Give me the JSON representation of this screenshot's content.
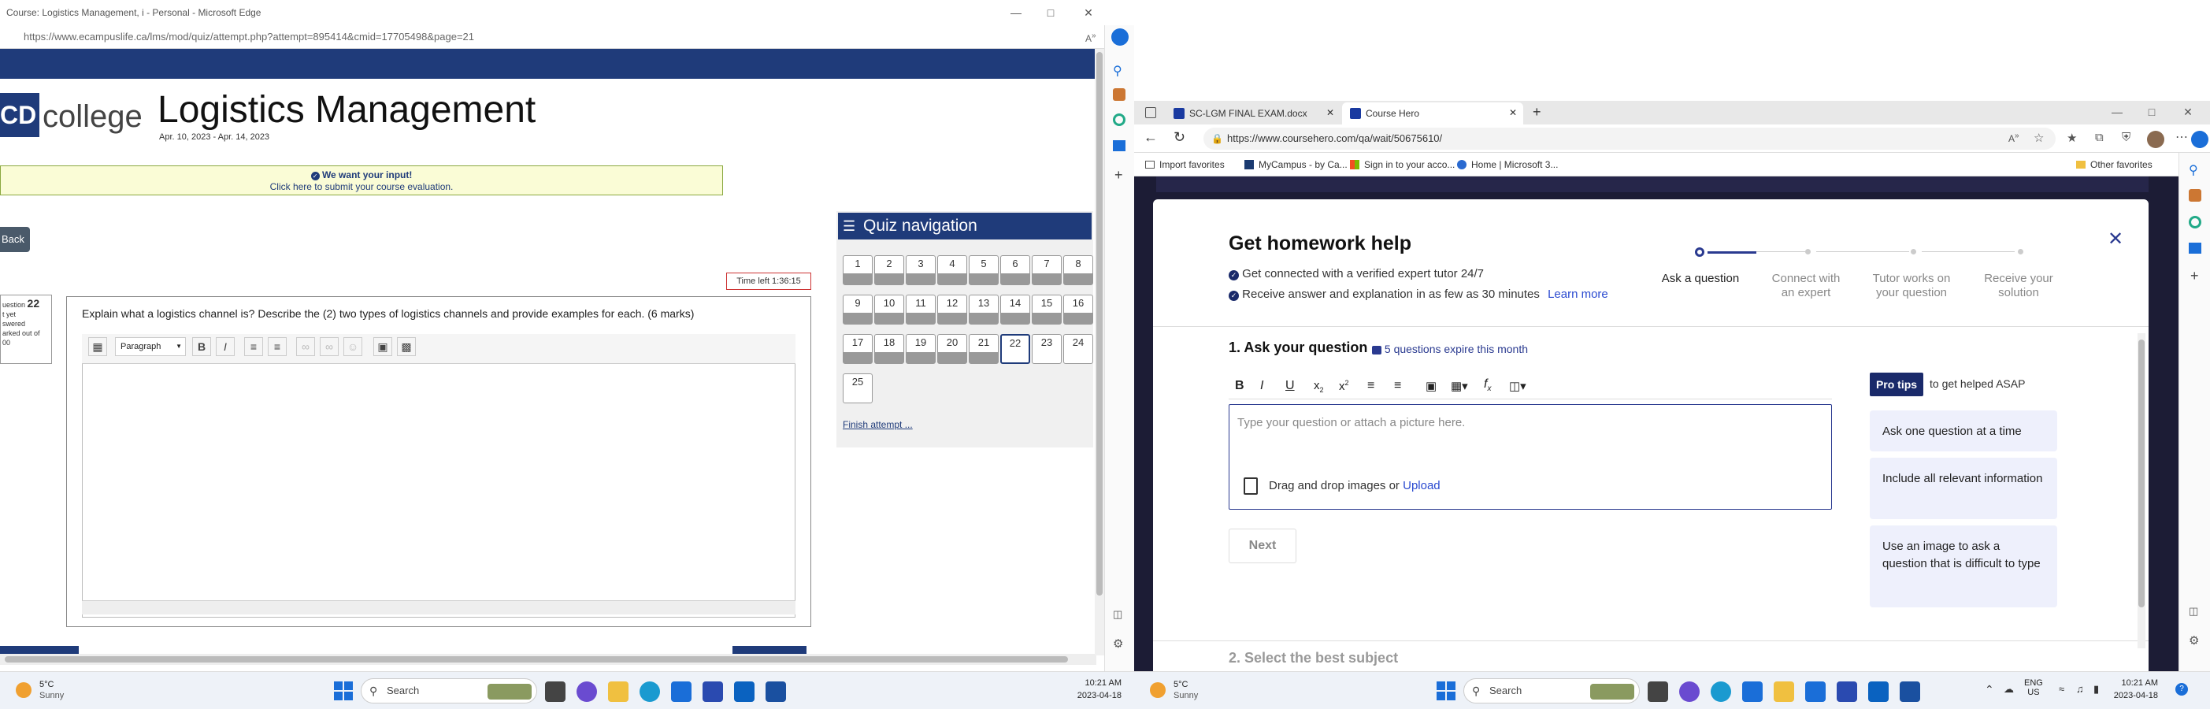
{
  "left": {
    "window_title": "Course: Logistics Management, i - Personal - Microsoft Edge",
    "url": "https://www.ecampuslife.ca/lms/mod/quiz/attempt.php?attempt=895414&cmid=17705498&page=21",
    "logo_abbr": "CD",
    "logo_college": "college",
    "course_title": "Logistics Management",
    "course_dates": "Apr. 10, 2023 - Apr. 14, 2023",
    "eval_heading": "We want your input!",
    "eval_link": "Click here to submit your course evaluation.",
    "back_label": "Back",
    "time_left": "Time left 1:36:15",
    "question_info": {
      "label": "uestion",
      "number": "22",
      "line1": "t yet",
      "line2": "swered",
      "line3": "arked out of",
      "line4": "00"
    },
    "question_text": "Explain what a logistics channel is? Describe the (2) two types of logistics channels and provide examples for each. (6 marks)",
    "editor_paragraph": "Paragraph",
    "quiz_nav_title": "Quiz navigation",
    "quiz_numbers": [
      "1",
      "2",
      "3",
      "4",
      "5",
      "6",
      "7",
      "8",
      "9",
      "10",
      "11",
      "12",
      "13",
      "14",
      "15",
      "16",
      "17",
      "18",
      "19",
      "20",
      "21",
      "22",
      "23",
      "24",
      "25"
    ],
    "current_question": "22",
    "finish_attempt": "Finish attempt ..."
  },
  "right": {
    "tabs": [
      {
        "label": "SC-LGM FINAL EXAM.docx"
      },
      {
        "label": "Course Hero"
      }
    ],
    "url": "https://www.coursehero.com/qa/wait/50675610/",
    "favorites": [
      "Import favorites",
      "MyCampus - by Ca...",
      "Sign in to your acco...",
      "Home | Microsoft 3..."
    ],
    "other_favorites": "Other favorites",
    "panel": {
      "title": "Get homework help",
      "bullet1": "Get connected with a verified expert tutor 24/7",
      "bullet2": "Receive answer and explanation in as few as 30 minutes",
      "learn_more": "Learn more",
      "steps": [
        {
          "line1": "Ask a question",
          "line2": ""
        },
        {
          "line1": "Connect with",
          "line2": "an expert"
        },
        {
          "line1": "Tutor works on",
          "line2": "your question"
        },
        {
          "line1": "Receive your",
          "line2": "solution"
        }
      ],
      "section1": "1. Ask your question",
      "expire_note": "5 questions expire this month",
      "placeholder": "Type your question or attach a picture here.",
      "drag_drop": "Drag and drop images or",
      "upload": "Upload",
      "next": "Next",
      "section2": "2. Select the best subject",
      "pro_tips_badge": "Pro tips",
      "pro_tips_text": "to get helped ASAP",
      "tips": [
        "Ask one question at a time",
        "Include all relevant information",
        "Use an image to ask a question that is difficult to type"
      ]
    }
  },
  "taskbar": {
    "weather_temp": "5°C",
    "weather_desc": "Sunny",
    "search_label": "Search",
    "time": "10:21 AM",
    "date": "2023-04-18",
    "lang1": "ENG",
    "lang2": "US"
  }
}
